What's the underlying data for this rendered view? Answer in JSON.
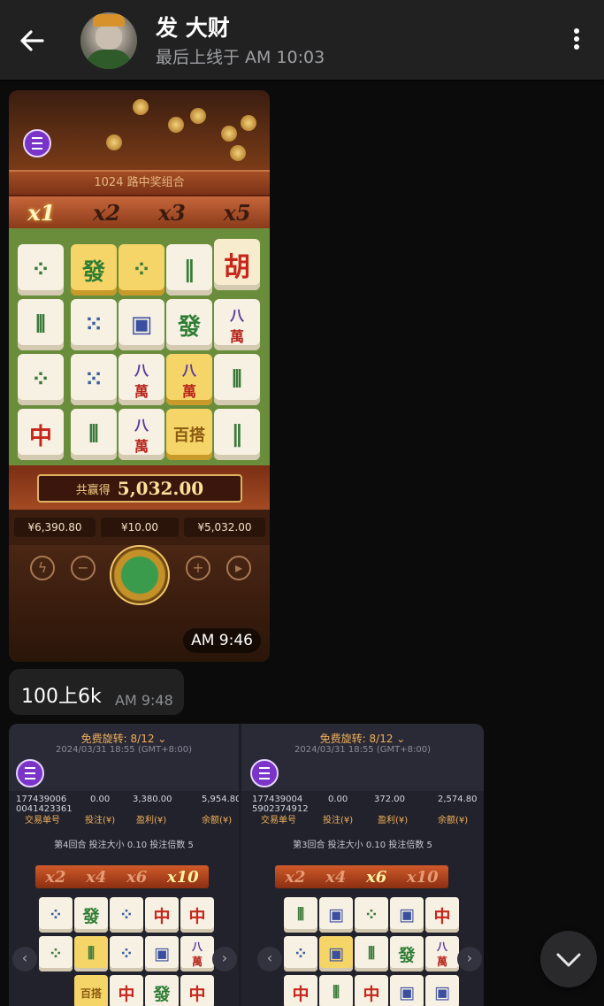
{
  "header": {
    "name": "发 大财",
    "status": "最后上线于 AM 10:03"
  },
  "messages": {
    "image1": {
      "time": "AM 9:46",
      "banner": "1024 路中奖组合",
      "multipliers": [
        "x1",
        "x2",
        "x3",
        "x5"
      ],
      "win_label": "共赢得",
      "win_amount": "5,032.00",
      "balance": "¥6,390.80",
      "bet": "¥10.00",
      "win": "¥5,032.00"
    },
    "text1": {
      "text": "100上6k",
      "time": "AM 9:48"
    },
    "image2": {
      "left": {
        "title": "免费旋转: 8/12 ⌄",
        "date": "2024/03/31 18:55 (GMT+8:00)",
        "id_line1": "177439006",
        "id_line2": "0041423361",
        "bet": "0.00",
        "profit": "3,380.00",
        "balance": "5,954.80",
        "id_label": "交易单号",
        "bet_label": "投注(¥)",
        "profit_label": "盈利(¥)",
        "balance_label": "余额(¥)",
        "round": "第4回合    投注大小 0.10    投注倍数 5",
        "multipliers": [
          "x2",
          "x4",
          "x6",
          "x10"
        ]
      },
      "right": {
        "title": "免费旋转: 8/12 ⌄",
        "date": "2024/03/31 18:55 (GMT+8:00)",
        "id_line1": "177439004",
        "id_line2": "5902374912",
        "bet": "0.00",
        "profit": "372.00",
        "balance": "2,574.80",
        "id_label": "交易单号",
        "bet_label": "投注(¥)",
        "profit_label": "盈利(¥)",
        "balance_label": "余额(¥)",
        "round": "第3回合    投注大小 0.10    投注倍数 5",
        "multipliers": [
          "x2",
          "x4",
          "x6",
          "x10"
        ]
      }
    }
  },
  "tiles": {
    "fa": "發",
    "zhong": "中",
    "hu": "胡",
    "ba": "八",
    "wan": "萬",
    "baida": "百搭"
  },
  "colors": {
    "header_bg": "#212121",
    "bubble_bg": "#212121",
    "page_bg": "#0b0b0c",
    "status_text": "#9ea0a4"
  },
  "icons": {
    "back": "arrow-left-icon",
    "menu": "more-vertical-icon",
    "scroll_down": "chevron-down-icon"
  }
}
